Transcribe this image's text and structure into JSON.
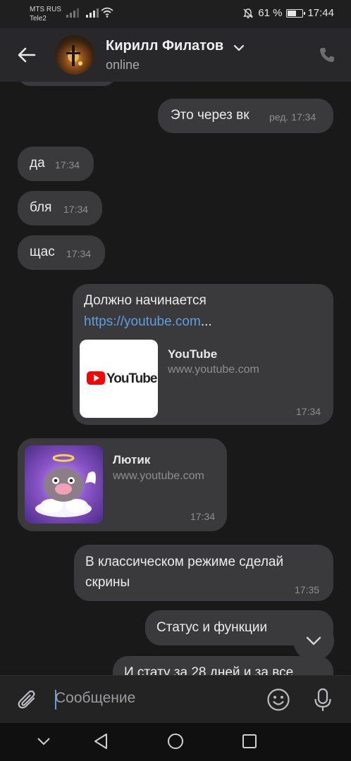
{
  "status_bar": {
    "carrier1": "MTS RUS",
    "carrier2": "Tele2",
    "battery_text": "61 %",
    "battery_level": 0.61,
    "time": "17:44"
  },
  "header": {
    "name": "Кирилл Филатов",
    "status": "online"
  },
  "messages": [
    {
      "text": "Это через вк",
      "time": "ред. 17:34",
      "side": "out"
    },
    {
      "text": "да",
      "time": "17:34",
      "side": "in"
    },
    {
      "text": "бля",
      "time": "17:34",
      "side": "in"
    },
    {
      "text": "щас",
      "time": "17:34",
      "side": "in"
    },
    {
      "text": "Должно начинается",
      "link": "https://youtube.com",
      "ellipsis": "...",
      "preview_title": "YouTube",
      "preview_site": "www.youtube.com",
      "preview_logo": "YouTube",
      "time": "17:34",
      "side": "out"
    },
    {
      "preview_title": "Лютик",
      "preview_site": "www.youtube.com",
      "time": "17:34",
      "side": "in"
    },
    {
      "text1": "В классическом режиме сделай",
      "text2": "скрины",
      "time": "17:35",
      "side": "out"
    },
    {
      "text": "Статус и функции",
      "side": "out"
    },
    {
      "text": "И стату за 28 дней и за все",
      "side": "out"
    }
  ],
  "composer": {
    "placeholder": "Сообщение"
  },
  "colors": {
    "background": "#19191a",
    "bubble": "#3a3a3c",
    "link": "#5d9fe0",
    "header": "#28282a"
  }
}
